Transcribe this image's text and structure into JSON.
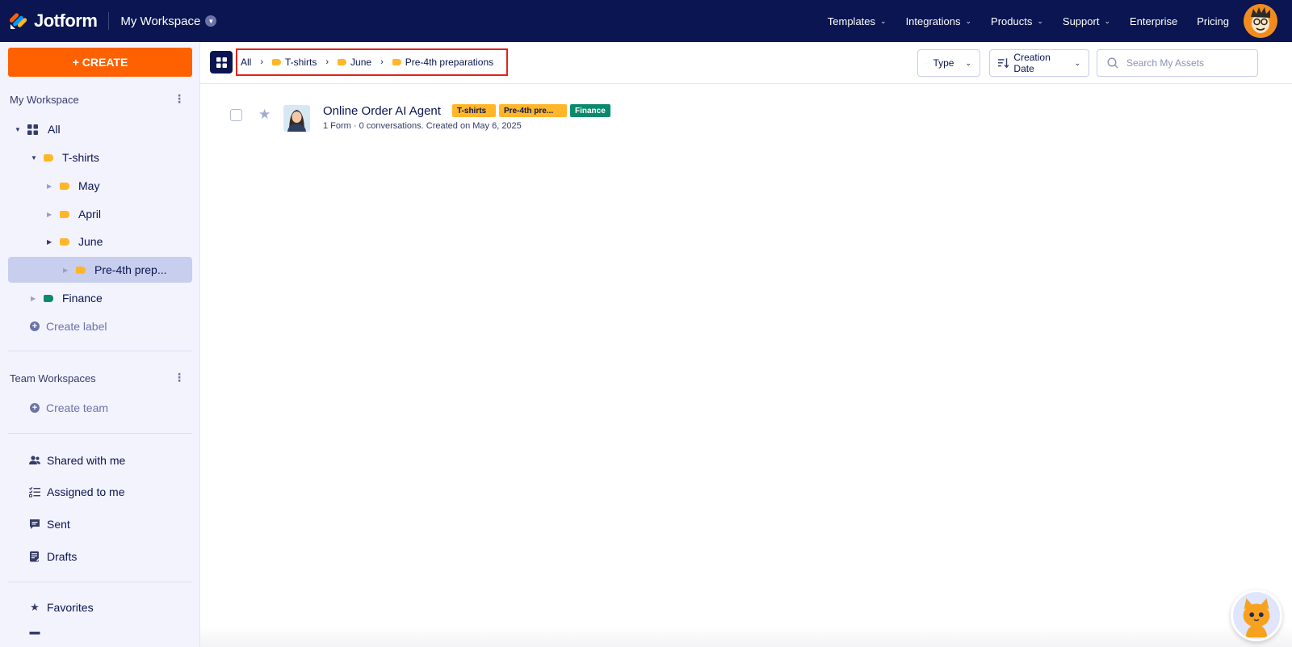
{
  "topbar": {
    "logo_text": "Jotform",
    "workspace_title": "My Workspace",
    "nav": [
      {
        "label": "Templates",
        "has_menu": true
      },
      {
        "label": "Integrations",
        "has_menu": true
      },
      {
        "label": "Products",
        "has_menu": true
      },
      {
        "label": "Support",
        "has_menu": true
      },
      {
        "label": "Enterprise",
        "has_menu": false
      },
      {
        "label": "Pricing",
        "has_menu": false
      }
    ]
  },
  "sidebar": {
    "create_label": "+ CREATE",
    "my_workspace_title": "My Workspace",
    "tree": [
      {
        "label": "All",
        "icon": "grid-icon"
      },
      {
        "label": "T-shirts",
        "icon": "label-icon",
        "color": "#ffb629"
      },
      {
        "label": "May",
        "icon": "label-icon",
        "color": "#ffb629"
      },
      {
        "label": "April",
        "icon": "label-icon",
        "color": "#ffb629"
      },
      {
        "label": "June",
        "icon": "label-icon",
        "color": "#ffb629"
      },
      {
        "label": "Pre-4th prep...",
        "icon": "label-icon",
        "color": "#ffb629",
        "active": true
      },
      {
        "label": "Finance",
        "icon": "label-icon",
        "color": "#0a8a6c"
      }
    ],
    "create_label_text": "Create label",
    "team_title": "Team Workspaces",
    "create_team_text": "Create team",
    "nav": [
      {
        "label": "Shared with me",
        "icon": "users-icon"
      },
      {
        "label": "Assigned to me",
        "icon": "checklist-icon"
      },
      {
        "label": "Sent",
        "icon": "message-icon"
      },
      {
        "label": "Drafts",
        "icon": "draft-icon"
      },
      {
        "label": "Favorites",
        "icon": "star-icon"
      }
    ]
  },
  "toolbar": {
    "breadcrumb": [
      {
        "label": "All"
      },
      {
        "label": "T-shirts",
        "color": "#ffb629"
      },
      {
        "label": "June",
        "color": "#ffb629"
      },
      {
        "label": "Pre-4th preparations",
        "color": "#ffb629"
      }
    ],
    "type_label": "Type",
    "sort_label": "Creation Date",
    "search_placeholder": "Search My Assets"
  },
  "assets": [
    {
      "title": "Online Order AI Agent",
      "badges": [
        {
          "label": "T-shirts",
          "color": "#ffb629"
        },
        {
          "label": "Pre-4th pre...",
          "color": "#ffb629"
        },
        {
          "label": "Finance",
          "color": "#0a8a6c"
        }
      ],
      "meta": "1 Form · 0 conversations. Created on May 6, 2025",
      "checked": false,
      "favorite": false
    }
  ],
  "colors": {
    "navy": "#0a1551",
    "create_orange": "#ff6100",
    "label_yellow": "#ffb629",
    "label_green": "#0a8a6c",
    "highlight_red": "#e0231e"
  }
}
